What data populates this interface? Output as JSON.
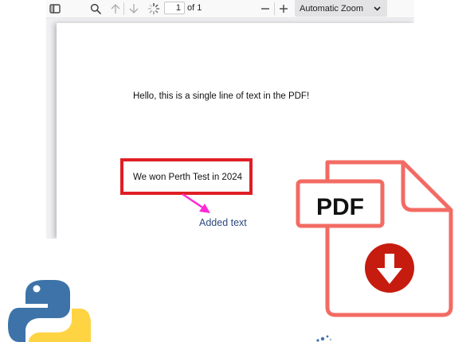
{
  "toolbar": {
    "sidebar_icon": "sidebar-toggle-icon",
    "search_icon": "search-icon",
    "prev_icon": "arrow-up-icon",
    "next_icon": "arrow-down-icon",
    "loading_icon": "spinner-icon",
    "page_number": "1",
    "page_total": "of 1",
    "zoom_out_icon": "minus-icon",
    "zoom_in_icon": "plus-icon",
    "zoom_value": "Automatic Zoom",
    "zoom_dropdown_icon": "chevron-down-icon"
  },
  "page": {
    "line1": "Hello, this is a single line of text in the PDF!",
    "line2": "We won Perth Test in 2024"
  },
  "annotation": {
    "label": "Added text",
    "highlight_color": "#e01e25",
    "arrow_color": "#ff2bd6"
  },
  "pdf_icon": {
    "label": "PDF",
    "outline_color": "#f26b63",
    "download_color": "#c61c0f"
  },
  "logos": {
    "python": "python-logo",
    "python_blue": "#3d73a8",
    "python_yellow": "#ffd443"
  }
}
